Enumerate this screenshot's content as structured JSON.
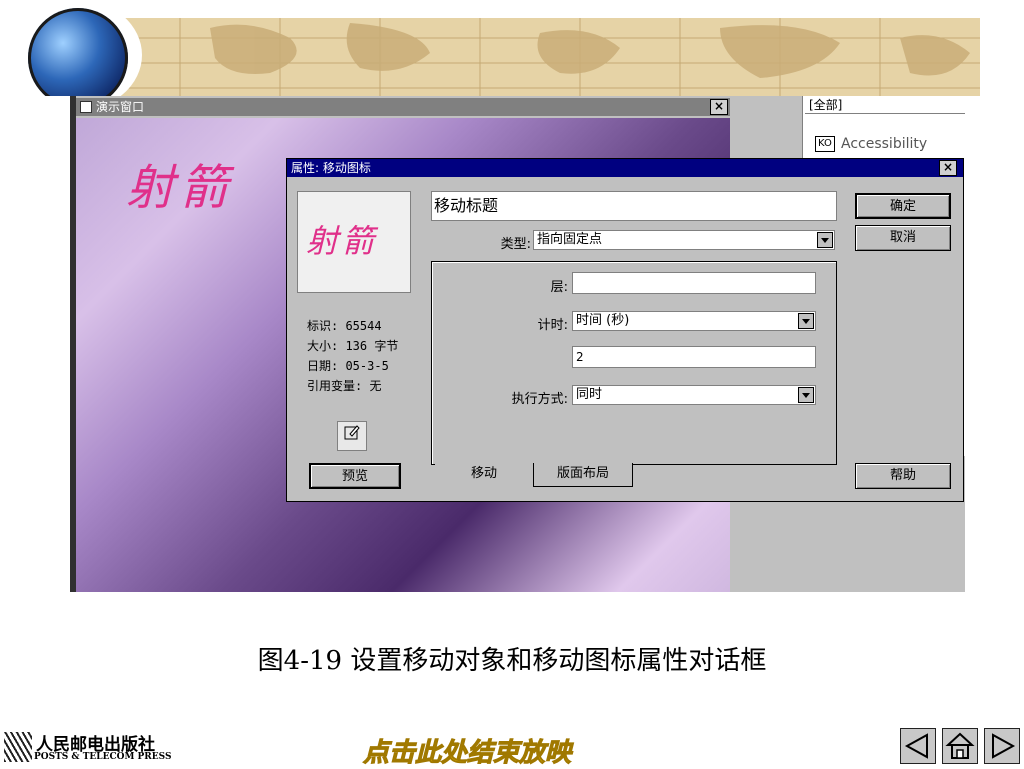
{
  "demo_window": {
    "title": "演示窗口",
    "close_glyph": "×",
    "display_title": "射箭"
  },
  "right_panel": {
    "dropdown_value": "[全部]",
    "item_label": "Accessibility",
    "item_icon_text": "KO"
  },
  "dialog": {
    "title": "属性: 移动图标",
    "close_glyph": "×",
    "preview_text": "射箭",
    "info": {
      "id": "标识: 65544",
      "size": "大小: 136 字节",
      "date": "日期: 05-3-5",
      "vars": "引用变量: 无"
    },
    "preview_button": "预览",
    "icon_name": "移动标题",
    "type_label": "类型:",
    "type_value": "指向固定点",
    "layer_label": "层:",
    "layer_value": "",
    "timing_label": "计时:",
    "timing_value": "时间 (秒)",
    "timing_amount": "2",
    "exec_label": "执行方式:",
    "exec_value": "同时",
    "tabs": [
      {
        "label": "移动",
        "active": true
      },
      {
        "label": "版面布局",
        "active": false
      }
    ],
    "ok_button": "确定",
    "cancel_button": "取消",
    "help_button": "帮助"
  },
  "caption": "图4-19  设置移动对象和移动图标属性对话框",
  "footer": {
    "publisher_cn": "人民邮电出版社",
    "publisher_en": "POSTS & TELECOM PRESS",
    "end_show": "点击此处结束放映"
  },
  "icons": [
    "shoot-icon",
    "edit-icon",
    "prev-arrow-icon",
    "home-icon",
    "next-arrow-icon"
  ],
  "colors": {
    "title_bar_active": "#000080",
    "title_bar_inactive": "#808080",
    "archery_text": "#e0308a",
    "end_show_text": "#e2b400"
  }
}
